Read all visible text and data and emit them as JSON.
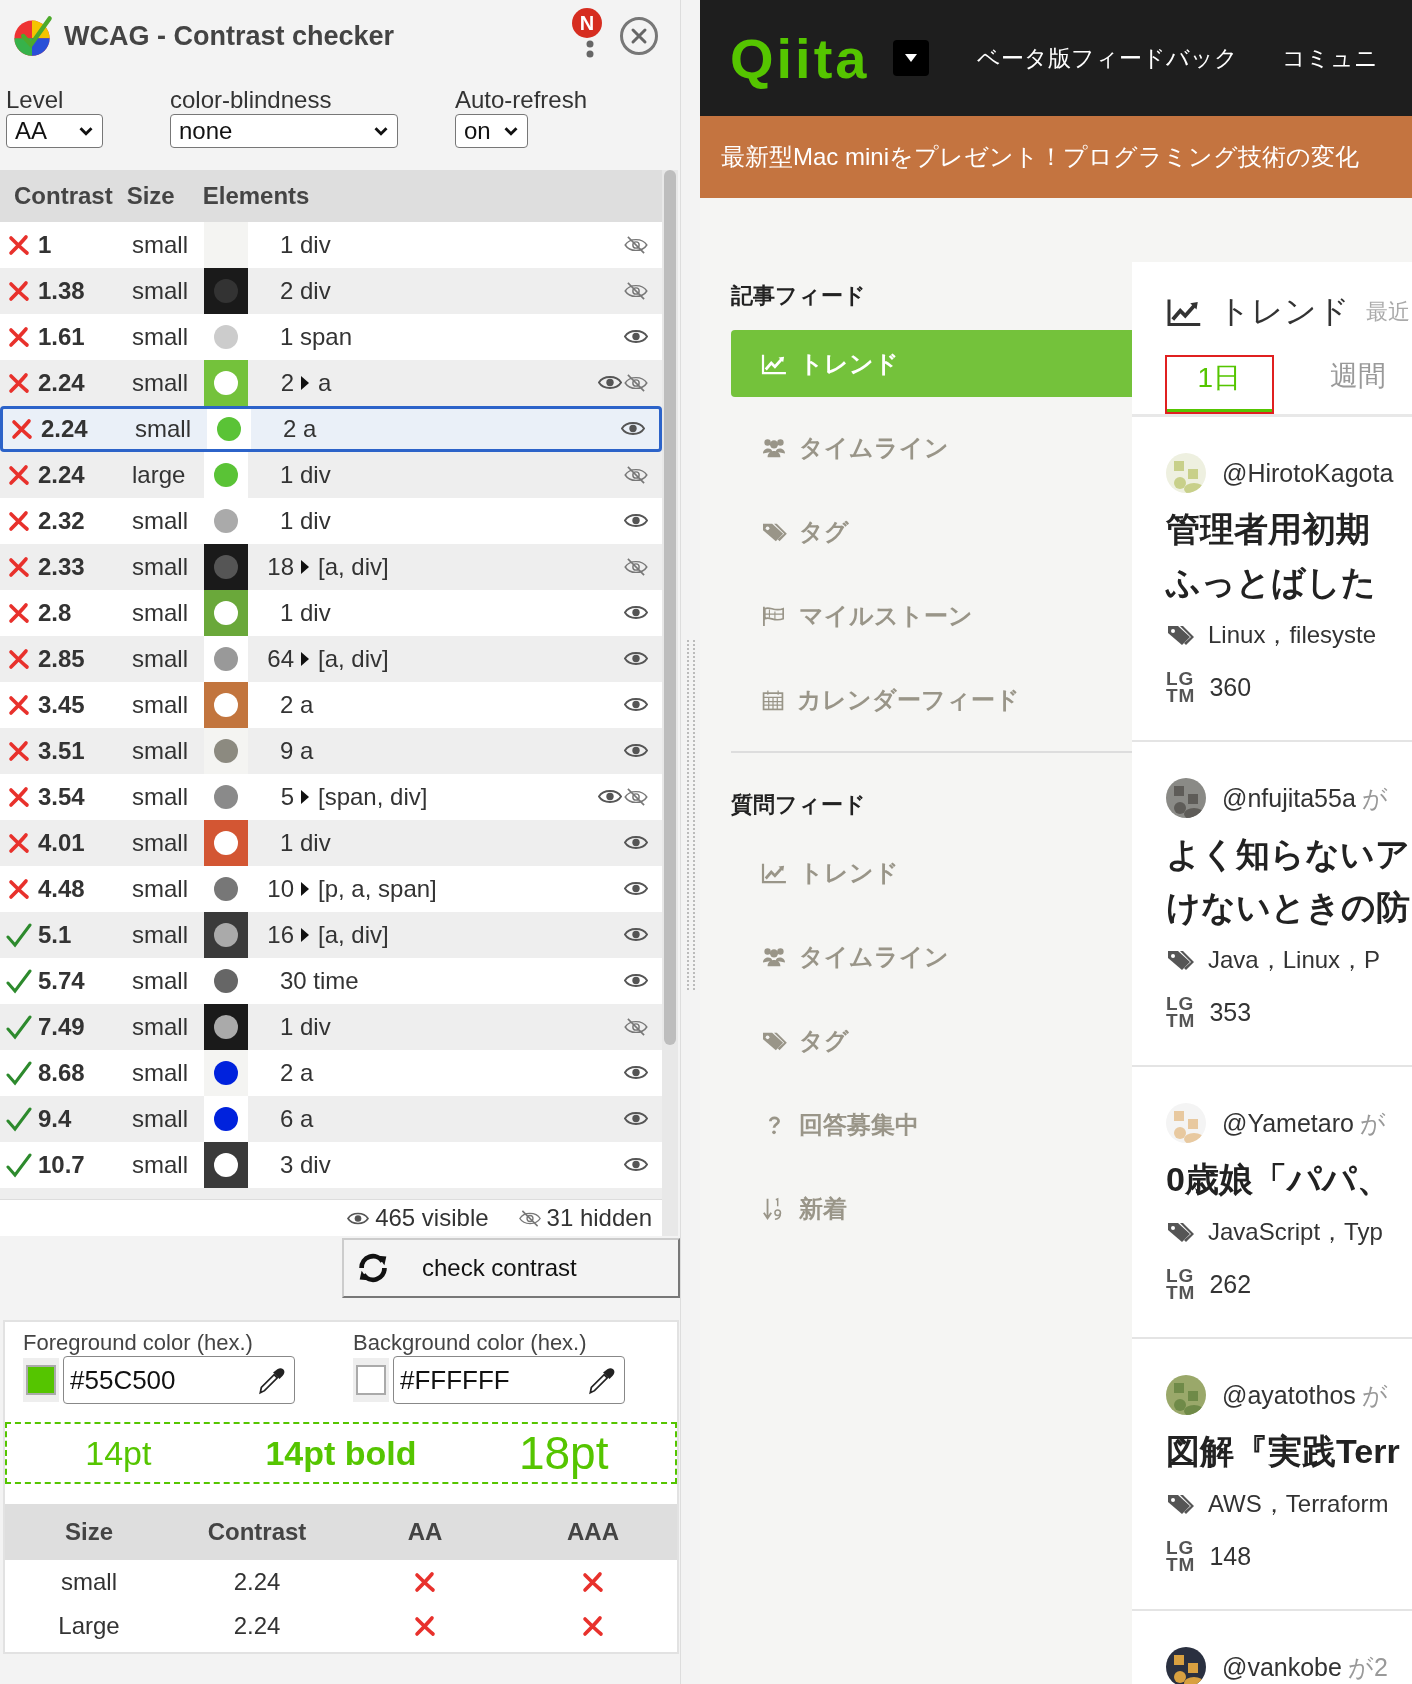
{
  "checker": {
    "title": "WCAG - Contrast checker",
    "badge": "N",
    "controls": [
      {
        "label": "Level",
        "value": "AA",
        "kind": "short"
      },
      {
        "label": "color-blindness",
        "value": "none",
        "kind": "wide"
      },
      {
        "label": "Auto-refresh",
        "value": "on",
        "kind": "narrow"
      }
    ],
    "columns": [
      "Contrast",
      "Size",
      "Elements"
    ],
    "rows": [
      {
        "pass": false,
        "contrast": "1",
        "size": "small",
        "swatch": {
          "color": "#f4f4f2"
        },
        "count": "1",
        "expandable": false,
        "elements": "div",
        "visible": false,
        "hidden": true,
        "selected": false
      },
      {
        "pass": false,
        "contrast": "1.38",
        "size": "small",
        "swatch": {
          "color": "#1a1a1a"
        },
        "dot": {
          "color": "#333333"
        },
        "count": "2",
        "expandable": false,
        "elements": "div",
        "visible": false,
        "hidden": true,
        "selected": false
      },
      {
        "pass": false,
        "contrast": "1.61",
        "size": "small",
        "swatch": {
          "color": "#ffffff"
        },
        "dot": {
          "color": "#cccccc"
        },
        "count": "1",
        "expandable": false,
        "elements": "span",
        "visible": true,
        "hidden": false,
        "selected": false
      },
      {
        "pass": false,
        "contrast": "2.24",
        "size": "small",
        "swatch": {
          "color": "#74c23b"
        },
        "dot": {
          "color": "#ffffff"
        },
        "count": "2",
        "expandable": true,
        "elements": "a",
        "visible": true,
        "hidden": true,
        "selected": false
      },
      {
        "pass": false,
        "contrast": "2.24",
        "size": "small",
        "swatch": {
          "color": "#ffffff"
        },
        "dot": {
          "color": "#5ac336"
        },
        "count": "2",
        "expandable": false,
        "elements": "a",
        "visible": true,
        "hidden": false,
        "selected": true
      },
      {
        "pass": false,
        "contrast": "2.24",
        "size": "large",
        "swatch": {
          "color": "#ffffff"
        },
        "dot": {
          "color": "#5ac336"
        },
        "count": "1",
        "expandable": false,
        "elements": "div",
        "visible": false,
        "hidden": true,
        "selected": false
      },
      {
        "pass": false,
        "contrast": "2.32",
        "size": "small",
        "swatch": {
          "color": "#ffffff"
        },
        "dot": {
          "color": "#aaaaaa"
        },
        "count": "1",
        "expandable": false,
        "elements": "div",
        "visible": true,
        "hidden": false,
        "selected": false
      },
      {
        "pass": false,
        "contrast": "2.33",
        "size": "small",
        "swatch": {
          "color": "#1a1a1a"
        },
        "dot": {
          "color": "#555555"
        },
        "count": "18",
        "expandable": true,
        "elements": "[a, div]",
        "visible": false,
        "hidden": true,
        "selected": false
      },
      {
        "pass": false,
        "contrast": "2.8",
        "size": "small",
        "swatch": {
          "color": "#6aa83a"
        },
        "dot": {
          "color": "#ffffff"
        },
        "count": "1",
        "expandable": false,
        "elements": "div",
        "visible": true,
        "hidden": false,
        "selected": false
      },
      {
        "pass": false,
        "contrast": "2.85",
        "size": "small",
        "swatch": {
          "color": "#ffffff"
        },
        "dot": {
          "color": "#999999"
        },
        "count": "64",
        "expandable": true,
        "elements": "[a, div]",
        "visible": true,
        "hidden": false,
        "selected": false
      },
      {
        "pass": false,
        "contrast": "3.45",
        "size": "small",
        "swatch": {
          "color": "#c2753e"
        },
        "dot": {
          "color": "#ffffff"
        },
        "count": "2",
        "expandable": false,
        "elements": "a",
        "visible": true,
        "hidden": false,
        "selected": false
      },
      {
        "pass": false,
        "contrast": "3.51",
        "size": "small",
        "swatch": {
          "color": "#f4f4f2"
        },
        "dot": {
          "color": "#8c8a80"
        },
        "count": "9",
        "expandable": false,
        "elements": "a",
        "visible": true,
        "hidden": false,
        "selected": false
      },
      {
        "pass": false,
        "contrast": "3.54",
        "size": "small",
        "swatch": {
          "color": "#ffffff"
        },
        "dot": {
          "color": "#8a8a8a"
        },
        "count": "5",
        "expandable": true,
        "elements": "[span, div]",
        "visible": true,
        "hidden": true,
        "selected": false
      },
      {
        "pass": false,
        "contrast": "4.01",
        "size": "small",
        "swatch": {
          "color": "#d35633"
        },
        "dot": {
          "color": "#ffffff"
        },
        "count": "1",
        "expandable": false,
        "elements": "div",
        "visible": true,
        "hidden": false,
        "selected": false
      },
      {
        "pass": false,
        "contrast": "4.48",
        "size": "small",
        "swatch": {
          "color": "#ffffff"
        },
        "dot": {
          "color": "#777777"
        },
        "count": "10",
        "expandable": true,
        "elements": "[p, a, span]",
        "visible": true,
        "hidden": false,
        "selected": false
      },
      {
        "pass": true,
        "contrast": "5.1",
        "size": "small",
        "swatch": {
          "color": "#3a3a3a"
        },
        "dot": {
          "color": "#aaaaaa"
        },
        "count": "16",
        "expandable": true,
        "elements": "[a, div]",
        "visible": true,
        "hidden": false,
        "selected": false
      },
      {
        "pass": true,
        "contrast": "5.74",
        "size": "small",
        "swatch": {
          "color": "#ffffff"
        },
        "dot": {
          "color": "#666666"
        },
        "count": "30",
        "expandable": false,
        "elements": "time",
        "visible": true,
        "hidden": false,
        "selected": false
      },
      {
        "pass": true,
        "contrast": "7.49",
        "size": "small",
        "swatch": {
          "color": "#1a1a1a"
        },
        "dot": {
          "color": "#aaaaaa"
        },
        "count": "1",
        "expandable": false,
        "elements": "div",
        "visible": false,
        "hidden": true,
        "selected": false
      },
      {
        "pass": true,
        "contrast": "8.68",
        "size": "small",
        "swatch": {
          "color": "#f4f4f2"
        },
        "dot": {
          "color": "#0022dd"
        },
        "count": "2",
        "expandable": false,
        "elements": "a",
        "visible": true,
        "hidden": false,
        "selected": false
      },
      {
        "pass": true,
        "contrast": "9.4",
        "size": "small",
        "swatch": {
          "color": "#ffffff"
        },
        "dot": {
          "color": "#0022dd"
        },
        "count": "6",
        "expandable": false,
        "elements": "a",
        "visible": true,
        "hidden": false,
        "selected": false
      },
      {
        "pass": true,
        "contrast": "10.7",
        "size": "small",
        "swatch": {
          "color": "#3a3a3a"
        },
        "dot": {
          "color": "#ffffff"
        },
        "count": "3",
        "expandable": false,
        "elements": "div",
        "visible": true,
        "hidden": false,
        "selected": false
      }
    ],
    "visible_count": "465 visible",
    "hidden_count": "31 hidden",
    "check_button": "check contrast",
    "colors": [
      {
        "label": "Foreground color (hex.)",
        "value": "#55C500"
      },
      {
        "label": "Background color (hex.)",
        "value": "#FFFFFF"
      }
    ],
    "preview": [
      {
        "text": "14pt",
        "kind": "normal"
      },
      {
        "text": "14pt bold",
        "kind": "bold"
      },
      {
        "text": "18pt",
        "kind": "large"
      }
    ],
    "results": {
      "columns": [
        "Size",
        "Contrast",
        "AA",
        "AAA"
      ],
      "rows": [
        {
          "size": "small",
          "contrast": "2.24",
          "aa": false,
          "aaa": false
        },
        {
          "size": "Large",
          "contrast": "2.24",
          "aa": false,
          "aaa": false
        }
      ]
    }
  },
  "site": {
    "logo": "Qiita",
    "nav": [
      "ベータ版フィードバック",
      "コミュニ"
    ],
    "banner": "最新型Mac miniをプレゼント！プログラミング技術の変化",
    "sidebar": [
      {
        "heading": "記事フィード",
        "items": [
          {
            "label": "トレンド",
            "kind": "chart",
            "selected": true
          },
          {
            "label": "タイムライン",
            "kind": "users",
            "selected": false
          },
          {
            "label": "タグ",
            "kind": "tag",
            "selected": false
          },
          {
            "label": "マイルストーン",
            "kind": "flag",
            "selected": false
          },
          {
            "label": "カレンダーフィード",
            "kind": "calendar",
            "selected": false
          }
        ]
      },
      {
        "heading": "質問フィード",
        "items": [
          {
            "label": "トレンド",
            "kind": "chart",
            "selected": false
          },
          {
            "label": "タイムライン",
            "kind": "users",
            "selected": false
          },
          {
            "label": "タグ",
            "kind": "tag",
            "selected": false
          },
          {
            "label": "回答募集中",
            "kind": "question",
            "selected": false
          },
          {
            "label": "新着",
            "kind": "sort",
            "selected": false
          }
        ]
      }
    ],
    "feed": {
      "title": "トレンド",
      "subtitle": "最近",
      "tabs": [
        {
          "label": "1日",
          "selected": true
        },
        {
          "label": "週間",
          "selected": false
        }
      ],
      "items": [
        {
          "user": "@HirotoKagota",
          "title_lines": [
            "管理者用初期",
            "ふっとばした"
          ],
          "tags": "Linux，filesyste",
          "lgtm": [
            "LG",
            "TM"
          ],
          "likes": "360"
        },
        {
          "user": "@nfujita55a",
          "meta": "が",
          "title_lines": [
            "よく知らないア",
            "けないときの防"
          ],
          "tags": "Java，Linux，P",
          "lgtm": [
            "LG",
            "TM"
          ],
          "likes": "353"
        },
        {
          "user": "@Yametaro",
          "meta": "が",
          "title_lines": [
            "0歳娘「パパ、"
          ],
          "tags": "JavaScript，Typ",
          "lgtm": [
            "LG",
            "TM"
          ],
          "likes": "262"
        },
        {
          "user": "@ayatothos",
          "meta": "が",
          "title_lines": [
            "図解『実践Terr"
          ],
          "tags": "AWS，Terraform",
          "lgtm": [
            "LG",
            "TM"
          ],
          "likes": "148"
        },
        {
          "user": "@vankobe",
          "meta": "が2"
        }
      ]
    }
  }
}
